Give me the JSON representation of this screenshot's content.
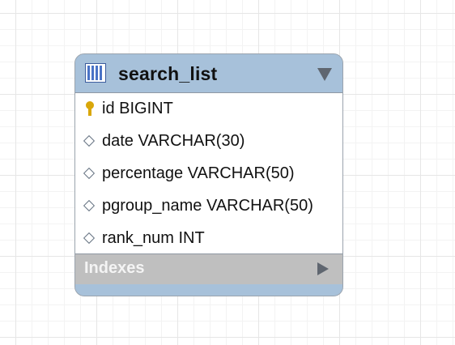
{
  "table": {
    "name": "search_list",
    "columns": [
      {
        "text": "id BIGINT",
        "icon": "primary-key-icon"
      },
      {
        "text": "date VARCHAR(30)",
        "icon": "column-diamond-icon"
      },
      {
        "text": "percentage VARCHAR(50)",
        "icon": "column-diamond-icon"
      },
      {
        "text": "pgroup_name VARCHAR(50)",
        "icon": "column-diamond-icon"
      },
      {
        "text": "rank_num INT",
        "icon": "column-diamond-icon"
      }
    ],
    "indexes_label": "Indexes"
  },
  "colors": {
    "header": "#a7c1da",
    "indexes": "#bfbfbf",
    "key": "#d9a70a"
  }
}
